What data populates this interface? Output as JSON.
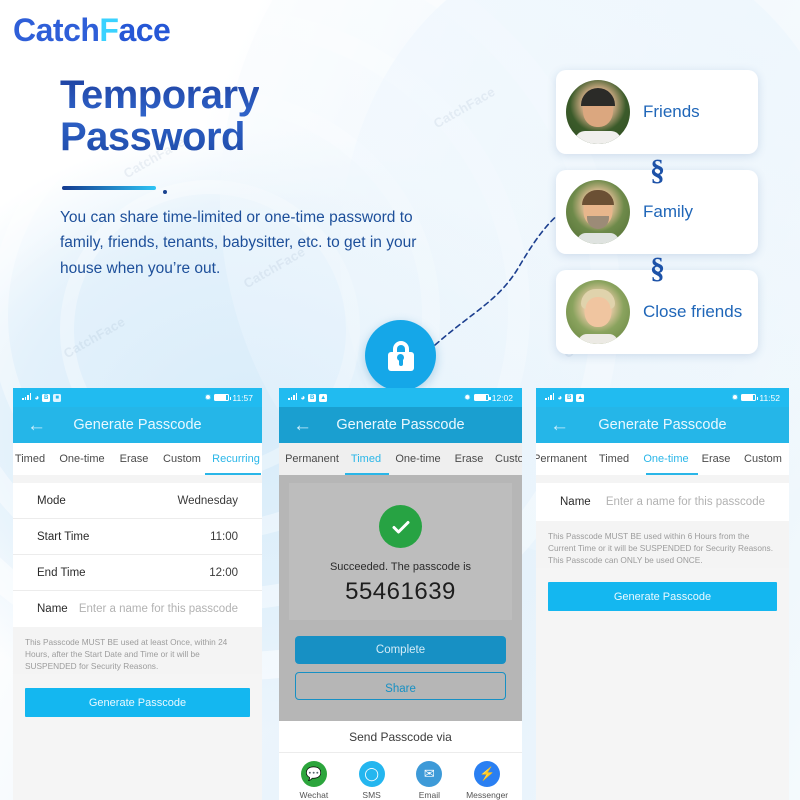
{
  "brand": {
    "part1": "Catch",
    "part2": "F",
    "part3": "ace",
    "accent": "#2f5fd8",
    "accent2": "#3ad2ff"
  },
  "hero": {
    "title_line1": "Temporary",
    "title_line2": "Password",
    "body": "You can share time-limited or one-time password to family, friends, tenants, babysitter, etc. to get in your house when you’re out."
  },
  "people": [
    {
      "label": "Friends",
      "avatar": "man-dark-hair-photo"
    },
    {
      "label": "Family",
      "avatar": "man-beard-photo"
    },
    {
      "label": "Close friends",
      "avatar": "woman-blonde-photo"
    }
  ],
  "lock": {
    "icon": "lock-icon"
  },
  "phones": [
    {
      "id": "phone-recurring",
      "status": {
        "time": "11:57",
        "signal": "signal-bars-icon",
        "wifi": "wifi-icon",
        "bluetooth": "bluetooth-icon",
        "battery": "battery-icon"
      },
      "appbar": {
        "back": "back-arrow-icon",
        "title": "Generate Passcode"
      },
      "tabs": [
        {
          "label": "Timed",
          "active": false
        },
        {
          "label": "One-time",
          "active": false
        },
        {
          "label": "Erase",
          "active": false
        },
        {
          "label": "Custom",
          "active": false
        },
        {
          "label": "Recurring",
          "active": true
        }
      ],
      "rows": [
        {
          "label": "Mode",
          "value": "Wednesday"
        },
        {
          "label": "Start Time",
          "value": "11:00"
        },
        {
          "label": "End Time",
          "value": "12:00"
        },
        {
          "label": "Name",
          "value": "",
          "placeholder": "Enter a name for this passcode"
        }
      ],
      "note": "This Passcode MUST BE used at least Once, within 24 Hours, after the Start Date and Time or it will be SUSPENDED for Security Reasons.",
      "button": "Generate Passcode"
    },
    {
      "id": "phone-result",
      "status": {
        "time": "12:02",
        "signal": "signal-bars-icon",
        "wifi": "wifi-icon",
        "bluetooth": "bluetooth-icon",
        "battery": "battery-icon"
      },
      "appbar": {
        "back": "back-arrow-icon",
        "title": "Generate Passcode"
      },
      "tabs": [
        {
          "label": "Permanent",
          "active": false
        },
        {
          "label": "Timed",
          "active": true
        },
        {
          "label": "One-time",
          "active": false
        },
        {
          "label": "Erase",
          "active": false
        },
        {
          "label": "Custom",
          "active": false
        }
      ],
      "result": {
        "icon": "success-check-icon",
        "message": "Succeeded. The passcode is",
        "passcode": "55461639"
      },
      "complete_button": "Complete",
      "share_button": "Share",
      "share_sheet": {
        "title": "Send Passcode via",
        "items": [
          {
            "name": "Wechat",
            "icon": "wechat-icon",
            "color": "#2ca53c"
          },
          {
            "name": "SMS",
            "icon": "sms-icon",
            "color": "#24b6ef"
          },
          {
            "name": "Email",
            "icon": "email-icon",
            "color": "#3d9ad8"
          },
          {
            "name": "Messenger",
            "icon": "messenger-icon",
            "color": "#2a7ff2"
          }
        ]
      }
    },
    {
      "id": "phone-one-time",
      "status": {
        "time": "11:52",
        "signal": "signal-bars-icon",
        "wifi": "wifi-icon",
        "bluetooth": "bluetooth-icon",
        "battery": "battery-icon"
      },
      "appbar": {
        "back": "back-arrow-icon",
        "title": "Generate Passcode"
      },
      "tabs": [
        {
          "label": "Permanent",
          "active": false
        },
        {
          "label": "Timed",
          "active": false
        },
        {
          "label": "One-time",
          "active": true
        },
        {
          "label": "Erase",
          "active": false
        },
        {
          "label": "Custom",
          "active": false
        }
      ],
      "rows": [
        {
          "label": "Name",
          "value": "",
          "placeholder": "Enter a name for this passcode"
        }
      ],
      "note": "This Passcode MUST BE used within 6 Hours from the Current Time or it will be SUSPENDED for Security Reasons. This Passcode can ONLY be used ONCE.",
      "button": "Generate Passcode"
    }
  ],
  "watermark": {
    "text": "CatchFace"
  }
}
